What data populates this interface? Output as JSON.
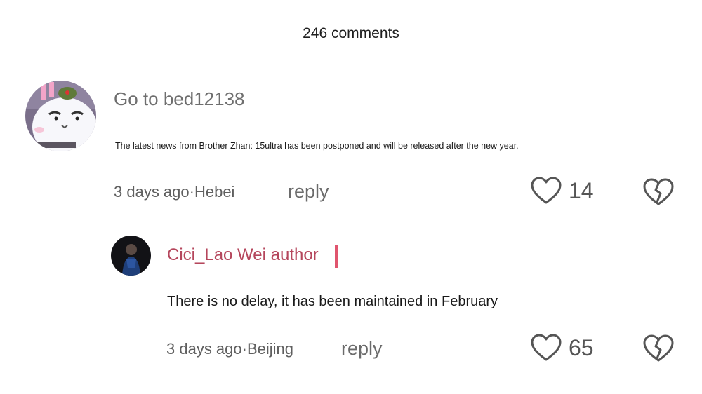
{
  "header": {
    "comment_count": "246 comments"
  },
  "comments": [
    {
      "username": "Go to bed12138",
      "avatar_icon": "cartoon-white-cat-avatar",
      "content": "The latest news from Brother Zhan: 15ultra has been postponed and will be released after the new year.",
      "meta": "3 days ago·Hebei",
      "reply_label": "reply",
      "likes": "14"
    }
  ],
  "replies": [
    {
      "username": "Cici_Lao Wei author",
      "avatar_icon": "person-photo-avatar",
      "content": "There is no delay, it has been maintained in February",
      "meta": "3 days ago·Beijing",
      "reply_label": "reply",
      "likes": "65"
    }
  ],
  "colors": {
    "author_name": "#b5465c",
    "author_bar": "#e0556e",
    "muted_text": "#6e6e6e"
  }
}
